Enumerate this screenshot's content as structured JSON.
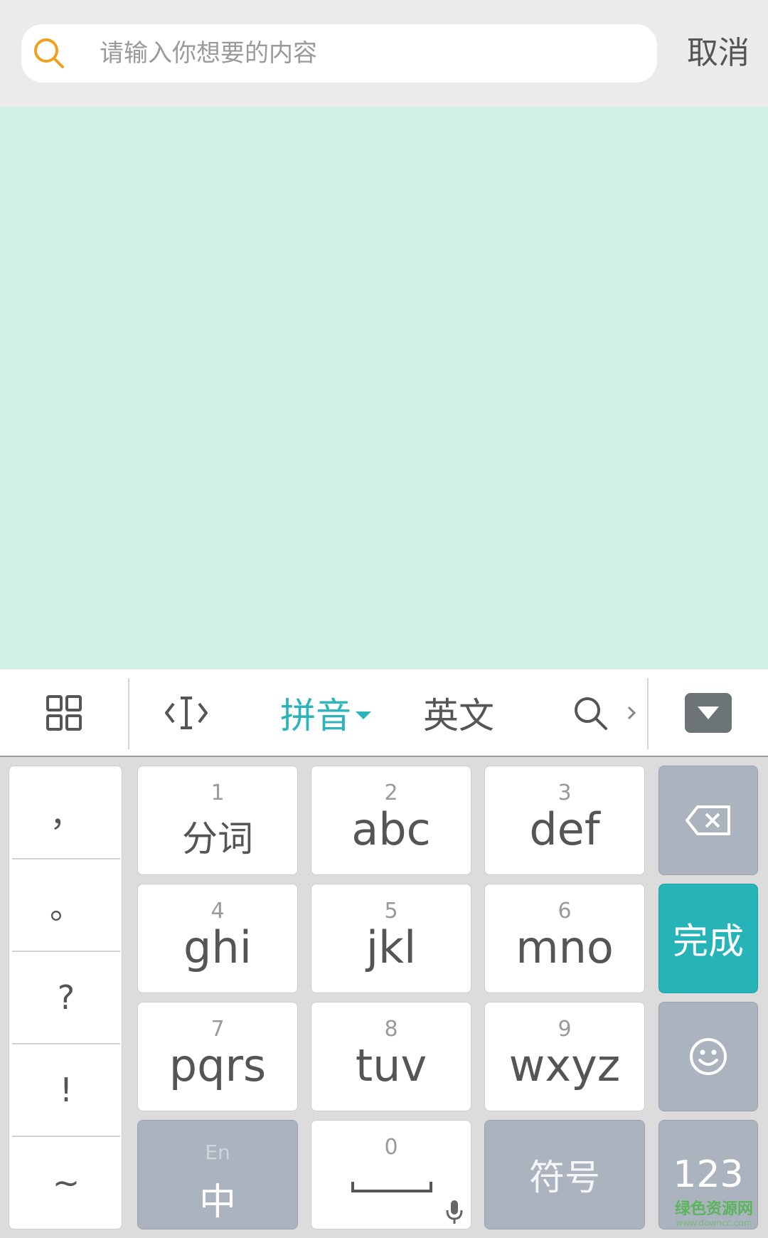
{
  "search": {
    "placeholder": "请输入你想要的内容",
    "cancel_label": "取消",
    "icon": "search-icon",
    "icon_color": "#f0a020"
  },
  "toolbar": {
    "items": [
      {
        "icon": "grid-menu-icon"
      },
      {
        "icon": "text-cursor-icon"
      },
      {
        "label": "拼音"
      },
      {
        "label": "英文"
      },
      {
        "icon": "search-icon"
      },
      {
        "icon": "chevron-right-icon"
      },
      {
        "icon": "hide-keyboard-icon"
      }
    ],
    "active_color": "#2bb5b8"
  },
  "keyboard": {
    "punctuation": [
      "，",
      "。",
      "?",
      "!",
      "~"
    ],
    "keys": [
      {
        "num": "1",
        "label": "分词"
      },
      {
        "num": "2",
        "label": "abc"
      },
      {
        "num": "3",
        "label": "def"
      },
      {
        "num": "4",
        "label": "ghi"
      },
      {
        "num": "5",
        "label": "jkl"
      },
      {
        "num": "6",
        "label": "mno"
      },
      {
        "num": "7",
        "label": "pqrs"
      },
      {
        "num": "8",
        "label": "tuv"
      },
      {
        "num": "9",
        "label": "wxyz"
      }
    ],
    "lang_key": {
      "sub": "En",
      "main": "中"
    },
    "space_key": {
      "num": "0"
    },
    "symbol_key": "符号",
    "done_key": "完成",
    "number_key": "123",
    "done_color": "#26b4b9"
  },
  "watermark": {
    "main": "绿色资源网",
    "sub": "www.downcc.com"
  }
}
